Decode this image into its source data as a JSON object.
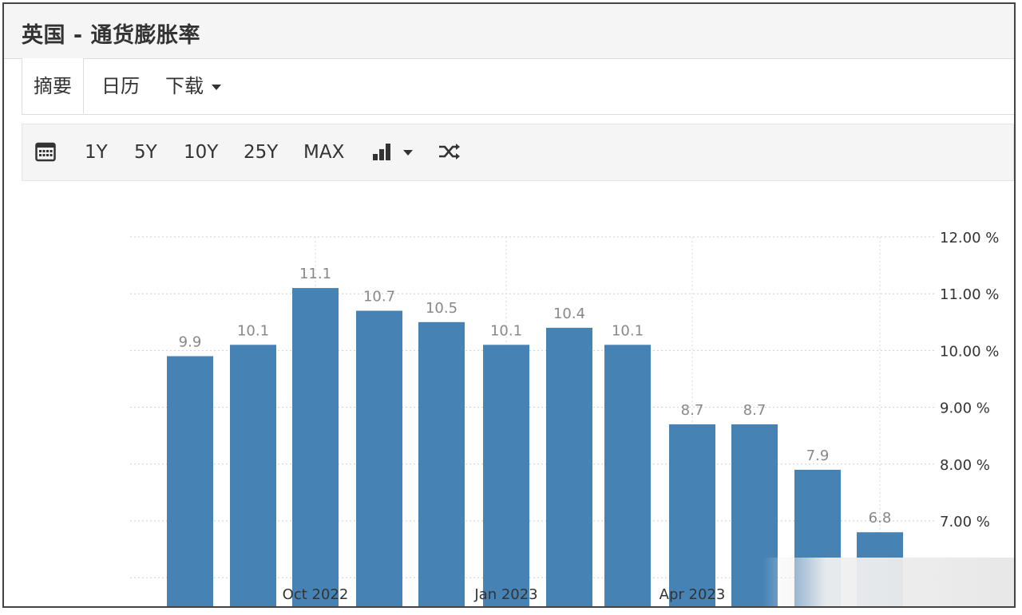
{
  "header": {
    "title": "英国 - 通货膨胀率"
  },
  "tabs": [
    {
      "label": "摘要"
    },
    {
      "label": "日历"
    },
    {
      "label": "下载"
    }
  ],
  "toolbar": {
    "calendar_icon": "calendar-icon",
    "ranges": [
      "1Y",
      "5Y",
      "10Y",
      "25Y",
      "MAX"
    ],
    "chart_type_icon": "bar-chart-icon",
    "shuffle_icon": "shuffle-icon"
  },
  "chart_data": {
    "type": "bar",
    "values": [
      9.9,
      10.1,
      11.1,
      10.7,
      10.5,
      10.1,
      10.4,
      10.1,
      8.7,
      8.7,
      7.9,
      6.8
    ],
    "data_labels": [
      "9.9",
      "10.1",
      "11.1",
      "10.7",
      "10.5",
      "10.1",
      "10.4",
      "10.1",
      "8.7",
      "8.7",
      "7.9",
      "6.8"
    ],
    "x_tick_labels": [
      "Oct 2022",
      "Jan 2023",
      "Apr 2023"
    ],
    "y_tick_labels": [
      "12.00 %",
      "11.00 %",
      "10.00 %",
      "9.00 %",
      "8.00 %",
      "7.00 %"
    ],
    "y_ticks": [
      12,
      11,
      10,
      9,
      8,
      7
    ],
    "ylim": [
      6,
      12
    ],
    "bar_color": "#4682b4",
    "grid": true,
    "y_axis_position": "right"
  }
}
